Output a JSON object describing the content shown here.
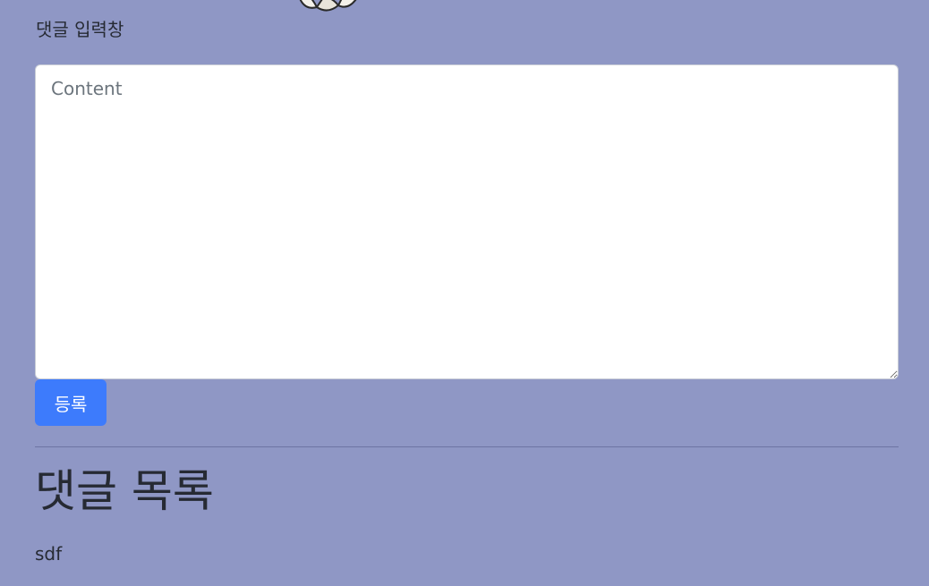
{
  "comment_form": {
    "label": "댓글 입력창",
    "placeholder": "Content",
    "submit_label": "등록"
  },
  "comment_list": {
    "title": "댓글 목록",
    "items": [
      {
        "content": "sdf"
      }
    ]
  }
}
